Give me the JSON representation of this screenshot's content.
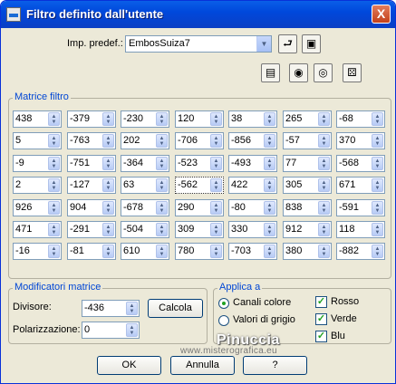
{
  "window": {
    "title": "Filtro definito dall'utente",
    "close_label": "X"
  },
  "preset": {
    "label": "Imp. predef.:",
    "value": "EmbosSuiza7"
  },
  "matrix": {
    "title": "Matrice filtro",
    "rows": [
      [
        "438",
        "-379",
        "-230",
        "120",
        "38",
        "265",
        "-68"
      ],
      [
        "5",
        "-763",
        "202",
        "-706",
        "-856",
        "-57",
        "370"
      ],
      [
        "-9",
        "-751",
        "-364",
        "-523",
        "-493",
        "77",
        "-568"
      ],
      [
        "2",
        "-127",
        "63",
        "-562",
        "422",
        "305",
        "671"
      ],
      [
        "926",
        "904",
        "-678",
        "290",
        "-80",
        "838",
        "-591"
      ],
      [
        "471",
        "-291",
        "-504",
        "309",
        "330",
        "912",
        "118"
      ],
      [
        "-16",
        "-81",
        "610",
        "780",
        "-703",
        "380",
        "-882"
      ]
    ]
  },
  "modifiers": {
    "title": "Modificatori matrice",
    "divisor_label": "Divisore:",
    "divisor_value": "-436",
    "bias_label": "Polarizzazione:",
    "bias_value": "0",
    "calc_button": "Calcola"
  },
  "apply": {
    "title": "Applica a",
    "radio_color": "Canali colore",
    "radio_gray": "Valori di grigio",
    "check_red": "Rosso",
    "check_green": "Verde",
    "check_blue": "Blu"
  },
  "buttons": {
    "ok": "OK",
    "cancel": "Annulla",
    "help": "?"
  },
  "watermark": {
    "name": "Pinuccia",
    "site": "www.misterografica.eu"
  }
}
